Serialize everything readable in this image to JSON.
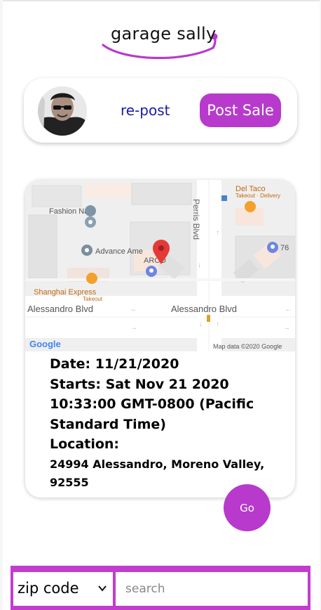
{
  "header": {
    "logo_text": "garage sally"
  },
  "profile": {
    "avatar_alt": "user avatar",
    "repost_label": "re-post",
    "post_sale_label": "Post Sale"
  },
  "map": {
    "labels": {
      "fashion_nails": "Fashion Nails",
      "advance_ame": "Advance Ame",
      "arco": "ARCO",
      "del_taco": "Del Taco",
      "del_taco_sub": "Takeout · Delivery",
      "shanghai": "Shanghai Express",
      "shanghai_sub": "Takeout",
      "street_left": "Alessandro Blvd",
      "street_right": "Alessandro Blvd",
      "perris": "Perris Blvd",
      "gas_76": "76",
      "google": "Google",
      "map_data": "Map data ©2020 Google"
    }
  },
  "sale": {
    "date_line": "Date: 11/21/2020",
    "starts_line1": "Starts: Sat Nov 21 2020",
    "starts_line2": "10:33:00 GMT-0800 (Pacific",
    "starts_line3": "Standard Time)",
    "location_label": "Location:",
    "address_line1": "24994 Alessandro, Moreno Valley,",
    "address_line2": "92555",
    "go_label": "Go"
  },
  "search": {
    "zip_selected": "zip code",
    "placeholder": "search"
  },
  "colors": {
    "accent": "#b83acc",
    "link": "#1a1aa8"
  }
}
